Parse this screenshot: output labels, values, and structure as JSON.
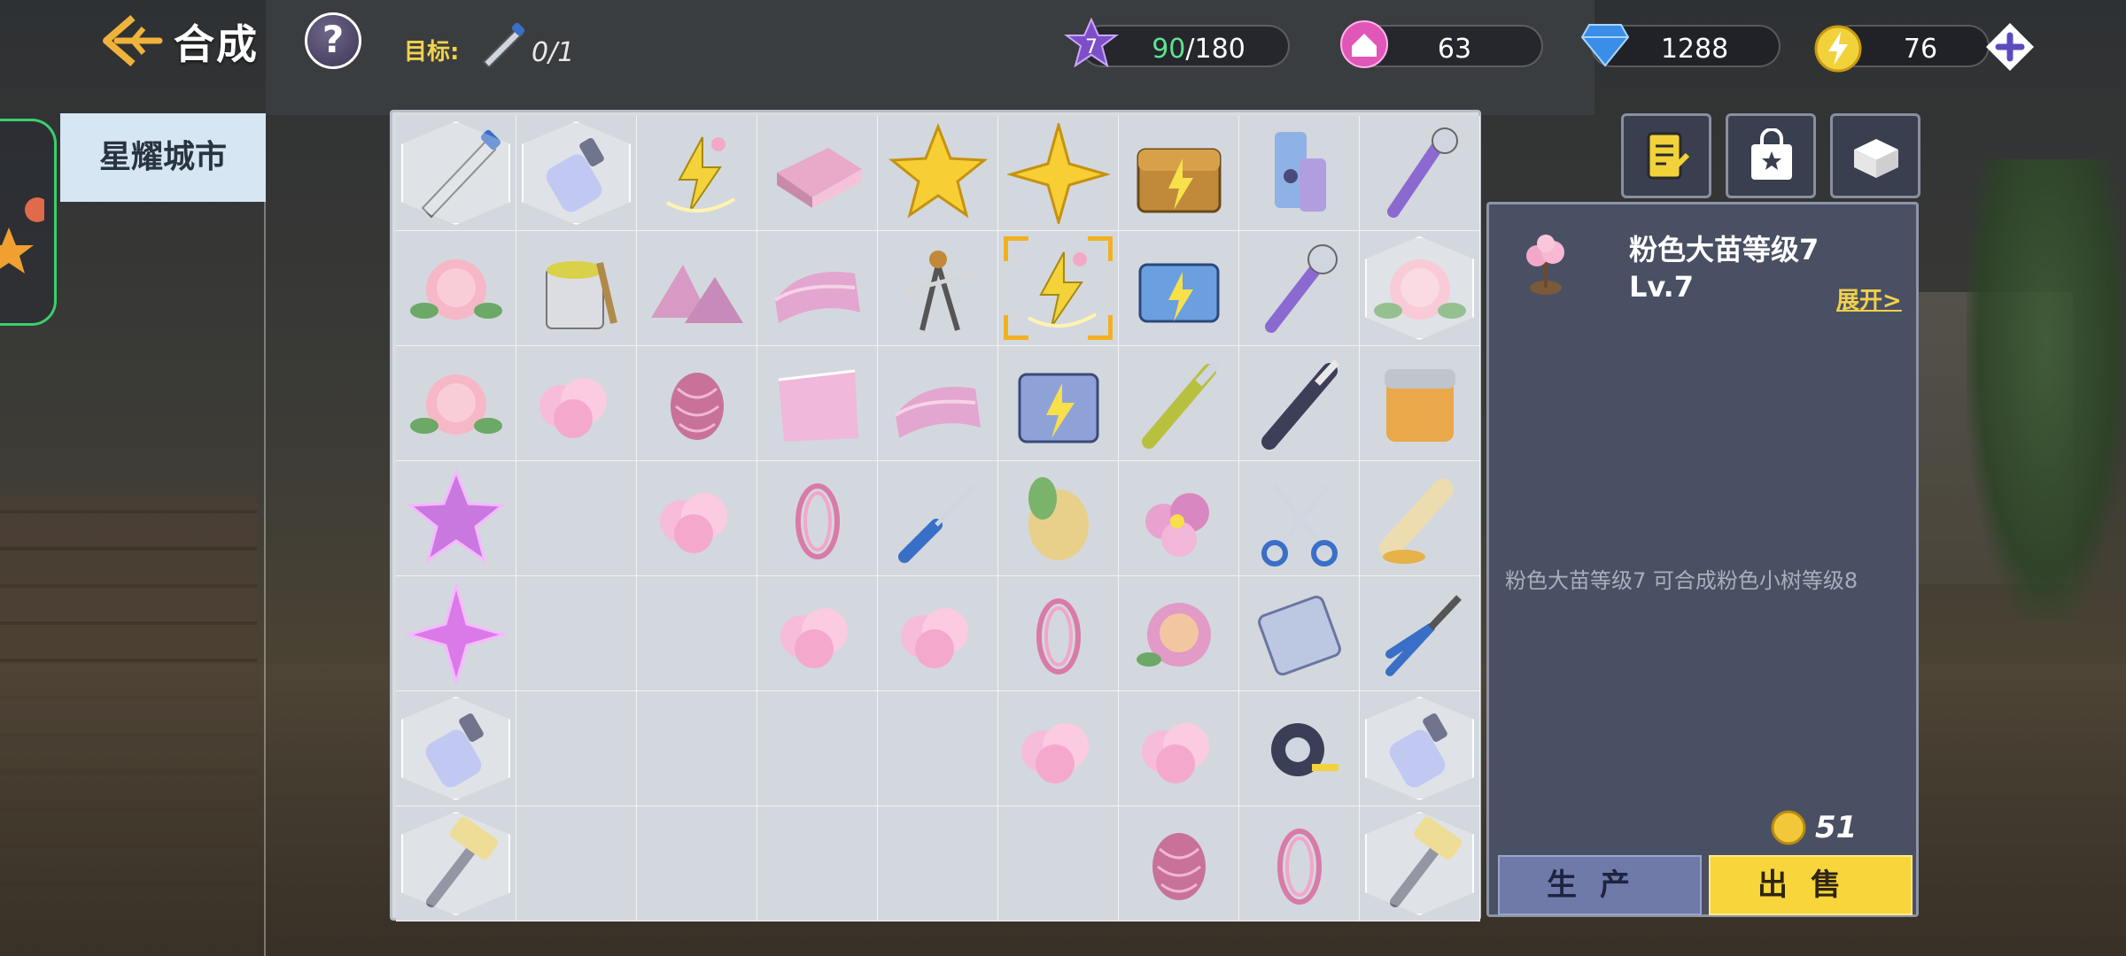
{
  "header": {
    "title": "合成",
    "help_symbol": "?",
    "goal_label": "目标:",
    "goal_progress": "0/1"
  },
  "resources": {
    "energy_level": "7",
    "energy_current": "90",
    "energy_max": "/180",
    "home_points": "63",
    "diamonds": "1288",
    "coins": "76"
  },
  "sidebar": {
    "city_tab": "星耀城市"
  },
  "board": {
    "rows": 7,
    "cols": 9,
    "cells": [
      [
        "saw-icon:locked",
        "glue-bottle-icon:locked",
        "energy-sprout-icon",
        "pink-cloth-icon",
        "gold-star-icon",
        "gold-sparkle-icon",
        "energy-chest-icon",
        "hinge-icon",
        "bottle-opener-icon"
      ],
      [
        "pink-peony-icon",
        "paint-bucket-icon",
        "pink-mountain-icon",
        "pink-fabric-icon",
        "compass-icon",
        "energy-sprout-icon:selected",
        "energy-box-icon",
        "wrench-icon",
        "pink-peony-icon:locked"
      ],
      [
        "pink-peony-icon",
        "pink-fluff-icon",
        "yarn-ball-icon",
        "pink-fur-icon",
        "pink-fabric-icon",
        "energy-crate-icon",
        "chisel-icon",
        "utility-knife-icon",
        "cream-jar-icon"
      ],
      [
        "pink-star-icon",
        "",
        "pink-fluff-icon",
        "pink-rope-icon",
        "screwdriver-icon",
        "pink-bulb-icon",
        "pink-flower-icon",
        "scissors-icon",
        "paint-tube-icon"
      ],
      [
        "pink-sparkle-icon",
        "",
        "",
        "pink-fluff-icon",
        "pink-fluff-icon",
        "pink-rope-icon",
        "rose-bloom-icon",
        "steel-hinge-icon",
        "pliers-icon"
      ],
      [
        "glue-bottle-icon:locked",
        "",
        "",
        "",
        "",
        "pink-fluff-icon",
        "pink-fluff-icon",
        "tape-measure-icon",
        "glue-bottle-icon:locked"
      ],
      [
        "hammer-icon:locked",
        "",
        "",
        "",
        "",
        "",
        "yarn-ball-icon",
        "pink-rope-icon",
        "hammer-icon:locked"
      ]
    ]
  },
  "tools": [
    "task-board-icon",
    "shop-bag-icon",
    "storage-box-icon"
  ],
  "detail": {
    "name": "粉色大苗等级7",
    "level": "Lv.7",
    "expand_label": "展开>",
    "description": "粉色大苗等级7 可合成粉色小树等级8",
    "price": "51",
    "produce_label": "生产",
    "sell_label": "出售"
  },
  "colors": {
    "accent_gold": "#f7d53b",
    "panel_bg": "#4a5063",
    "energy_purple": "#7d4fc6",
    "home_pink": "#e057b8",
    "diamond_blue": "#3a8ee8",
    "coin_yellow": "#f2d23a"
  }
}
